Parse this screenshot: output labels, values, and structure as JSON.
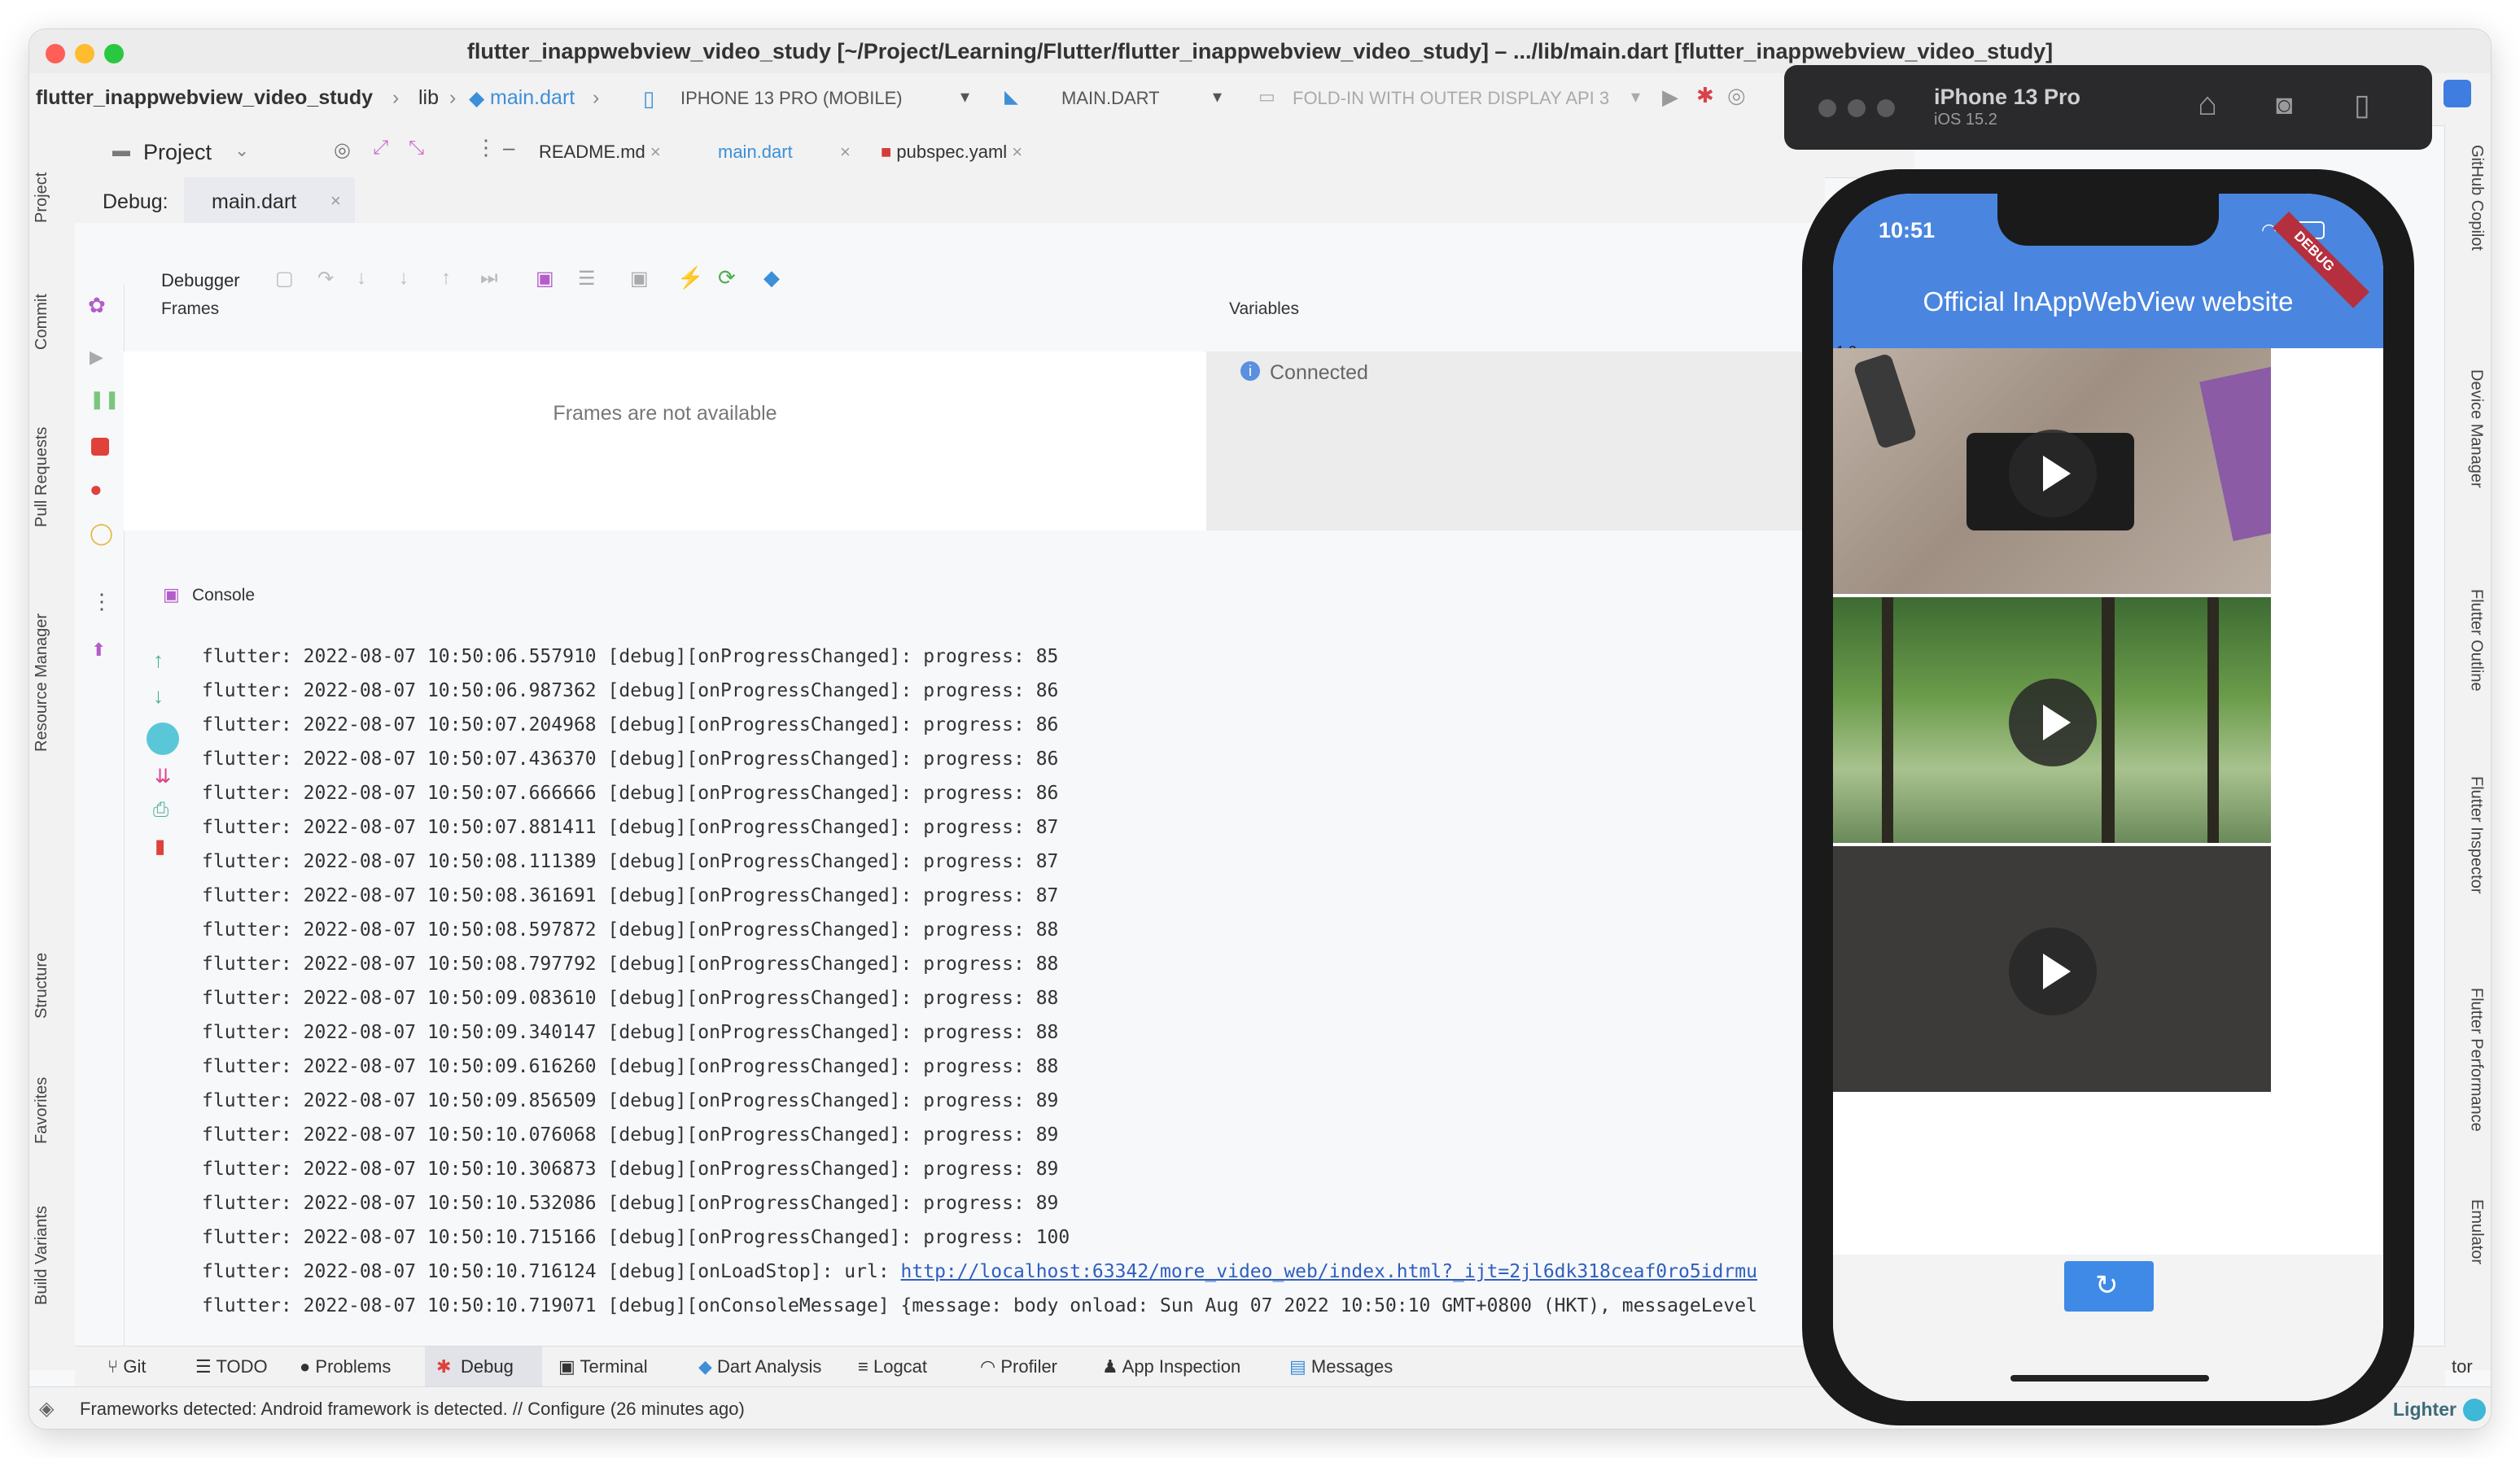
{
  "window": {
    "title": "flutter_inappwebview_video_study [~/Project/Learning/Flutter/flutter_inappwebview_video_study] – .../lib/main.dart [flutter_inappwebview_video_study]"
  },
  "navbar": {
    "breadcrumb": [
      "flutter_inappwebview_video_study",
      "lib",
      "main.dart"
    ],
    "device": "IPHONE 13 PRO (MOBILE)",
    "run_config": "MAIN.DART",
    "emulator": "FOLD-IN WITH OUTER DISPLAY API 3"
  },
  "project_panel": {
    "title": "Project"
  },
  "editor_tabs": [
    "README.md",
    "main.dart",
    "pubspec.yaml"
  ],
  "left_tabs": [
    "Project",
    "Commit",
    "Pull Requests",
    "Resource Manager",
    "Structure",
    "Favorites",
    "Build Variants"
  ],
  "right_tabs": [
    "GitHub Copilot",
    "Device Manager",
    "Flutter Outline",
    "Flutter Inspector",
    "Flutter Performance",
    "Emulator"
  ],
  "debug": {
    "label": "Debug:",
    "tab": "main.dart",
    "debugger_label": "Debugger",
    "frames_header": "Frames",
    "frames_empty": "Frames are not available",
    "variables_header": "Variables",
    "variables_status": "Connected",
    "console_label": "Console"
  },
  "console": {
    "lines": [
      "flutter: 2022-08-07 10:50:06.557910 [debug][onProgressChanged]: progress: 85",
      "flutter: 2022-08-07 10:50:06.987362 [debug][onProgressChanged]: progress: 86",
      "flutter: 2022-08-07 10:50:07.204968 [debug][onProgressChanged]: progress: 86",
      "flutter: 2022-08-07 10:50:07.436370 [debug][onProgressChanged]: progress: 86",
      "flutter: 2022-08-07 10:50:07.666666 [debug][onProgressChanged]: progress: 86",
      "flutter: 2022-08-07 10:50:07.881411 [debug][onProgressChanged]: progress: 87",
      "flutter: 2022-08-07 10:50:08.111389 [debug][onProgressChanged]: progress: 87",
      "flutter: 2022-08-07 10:50:08.361691 [debug][onProgressChanged]: progress: 87",
      "flutter: 2022-08-07 10:50:08.597872 [debug][onProgressChanged]: progress: 88",
      "flutter: 2022-08-07 10:50:08.797792 [debug][onProgressChanged]: progress: 88",
      "flutter: 2022-08-07 10:50:09.083610 [debug][onProgressChanged]: progress: 88",
      "flutter: 2022-08-07 10:50:09.340147 [debug][onProgressChanged]: progress: 88",
      "flutter: 2022-08-07 10:50:09.616260 [debug][onProgressChanged]: progress: 88",
      "flutter: 2022-08-07 10:50:09.856509 [debug][onProgressChanged]: progress: 89",
      "flutter: 2022-08-07 10:50:10.076068 [debug][onProgressChanged]: progress: 89",
      "flutter: 2022-08-07 10:50:10.306873 [debug][onProgressChanged]: progress: 89",
      "flutter: 2022-08-07 10:50:10.532086 [debug][onProgressChanged]: progress: 89",
      "flutter: 2022-08-07 10:50:10.715166 [debug][onProgressChanged]: progress: 100"
    ],
    "load_stop_prefix": "flutter: 2022-08-07 10:50:10.716124 [debug][onLoadStop]: url: ",
    "load_stop_url": "http://localhost:63342/more_video_web/index.html?_ijt=2jl6dk318ceaf0ro5idrmu",
    "console_message": "flutter: 2022-08-07 10:50:10.719071 [debug][onConsoleMessage] {message: body onload: Sun Aug 07 2022 10:50:10 GMT+0800 (HKT), messageLevel"
  },
  "bottom_tabs": [
    "Git",
    "TODO",
    "Problems",
    "Debug",
    "Terminal",
    "Dart Analysis",
    "Logcat",
    "Profiler",
    "App Inspection",
    "Messages"
  ],
  "bottom_right_fragment": "tor",
  "status": {
    "message": "Frameworks detected: Android framework is detected. // Configure (26 minutes ago)",
    "theme": "Lighter"
  },
  "simulator": {
    "device_name": "iPhone 13 Pro",
    "os_version": "iOS 15.2",
    "time": "10:51",
    "debug_banner": "DEBUG",
    "app_title": "Official InAppWebView website",
    "scale_label": "1.0"
  },
  "colors": {
    "accent_blue": "#4a86e0",
    "link": "#2f5fbf",
    "stop_red": "#e0413b"
  }
}
